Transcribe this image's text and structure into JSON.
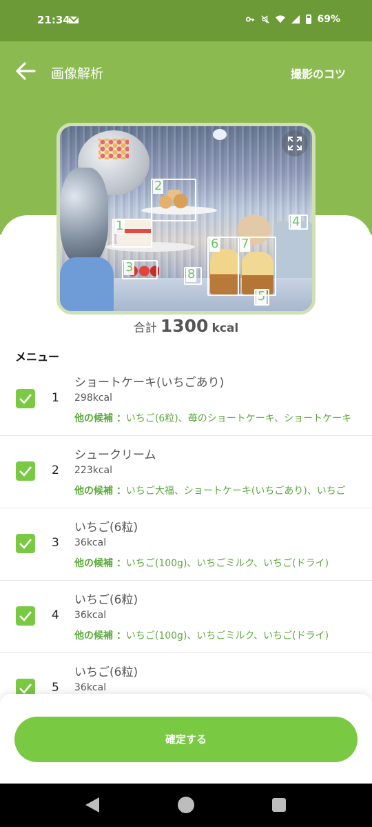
{
  "status_bar": {
    "time": "21:34",
    "battery": "69%"
  },
  "header": {
    "title": "画像解析",
    "tips": "撮影のコツ"
  },
  "detections": [
    "1",
    "2",
    "3",
    "4",
    "5",
    "6",
    "7",
    "8"
  ],
  "total": {
    "label": "合計",
    "value": "1300",
    "unit": "kcal"
  },
  "menu_heading": "メニュー",
  "candidates_label": "他の候補 ：",
  "items": [
    {
      "index": "1",
      "name": "ショートケーキ(いちごあり)",
      "kcal": "298kcal",
      "candidates": "いちご(6粒)、苺のショートケーキ、ショートケーキ",
      "checked": true
    },
    {
      "index": "2",
      "name": "シュークリーム",
      "kcal": "223kcal",
      "candidates": "いちご大福、ショートケーキ(いちごあり)、いちご",
      "checked": true
    },
    {
      "index": "3",
      "name": "いちご(6粒)",
      "kcal": "36kcal",
      "candidates": "いちご(100g)、いちごミルク、いちご(ドライ)",
      "checked": true
    },
    {
      "index": "4",
      "name": "いちご(6粒)",
      "kcal": "36kcal",
      "candidates": "いちご(100g)、いちごミルク、いちご(ドライ)",
      "checked": true
    },
    {
      "index": "5",
      "name": "いちご(6粒)",
      "kcal": "36kcal",
      "candidates": "",
      "checked": true
    }
  ],
  "confirm_button": "確定する",
  "colors": {
    "primary": "#7ac943",
    "header": "#8bbb50",
    "status_bar": "#6b9a36",
    "candidate_text": "#5aaa3c"
  }
}
